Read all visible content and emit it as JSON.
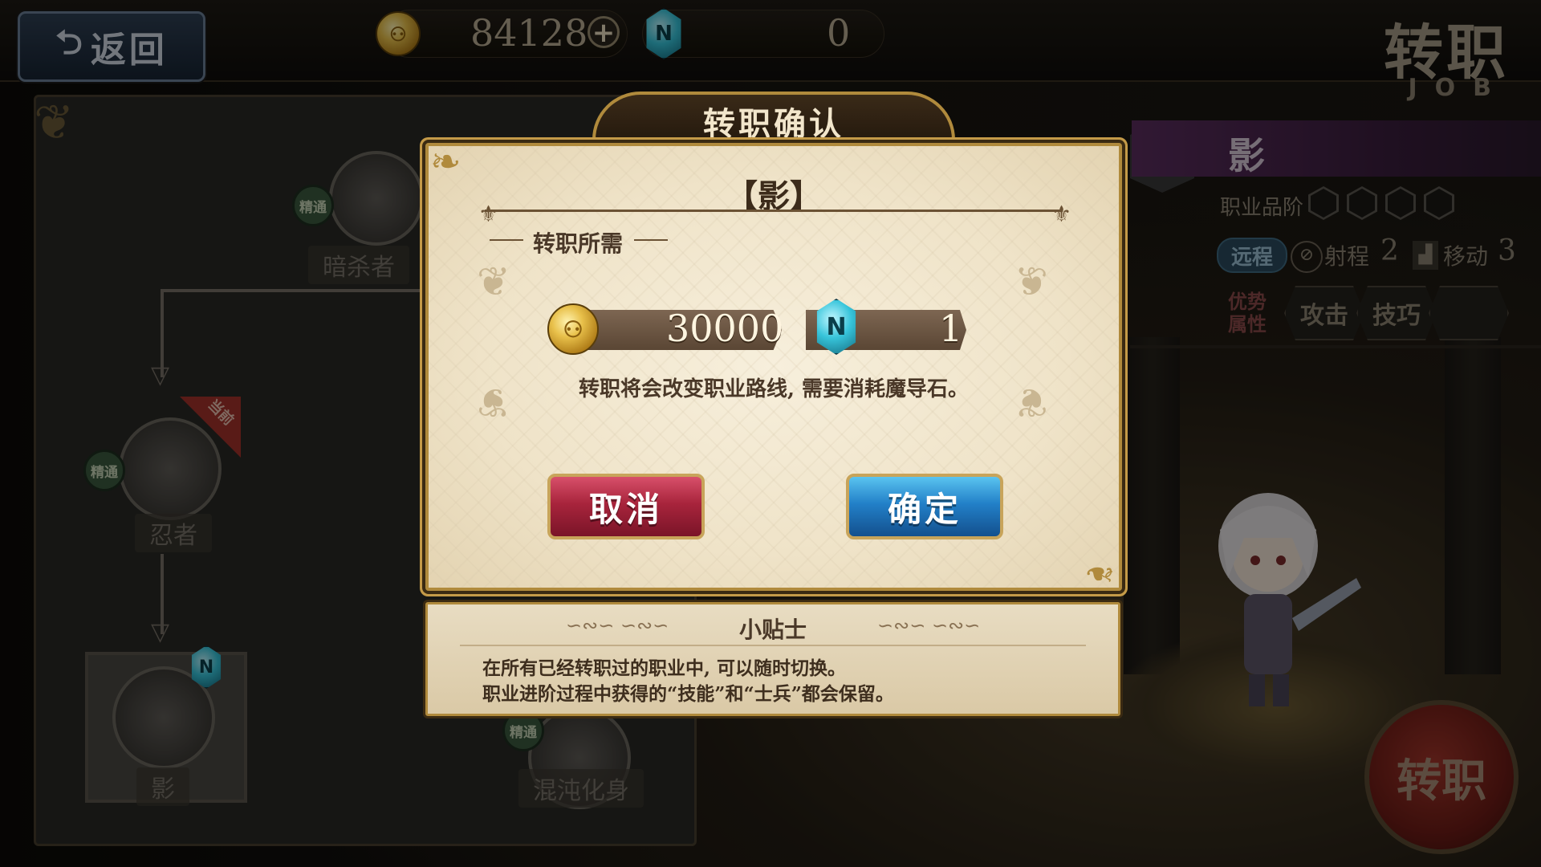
{
  "topbar": {
    "back_label": "返回",
    "coin_amount": "84128",
    "gem_amount": "0",
    "screen_title": "转职",
    "screen_subtitle": "JOB"
  },
  "tree": {
    "nodes": [
      {
        "name": "暗杀者",
        "badge": "精通"
      },
      {
        "name": "忍者",
        "badge": "精通",
        "tag": "当前"
      },
      {
        "name": "影"
      },
      {
        "name": "混沌化身",
        "badge": "精通"
      }
    ]
  },
  "right_panel": {
    "class_name": "影",
    "rank_label": "职业品阶",
    "range_type": "远程",
    "range_label": "射程",
    "range_value": "2",
    "move_label": "移动",
    "move_value": "3",
    "advantage_label_1": "优势",
    "advantage_label_2": "属性",
    "attributes": [
      "攻击",
      "技巧",
      ""
    ],
    "action_button": "转职"
  },
  "dialog": {
    "title": "转职确认",
    "job_name": "【影】",
    "requirement_label": "转职所需",
    "coin_cost": "30000",
    "gem_cost": "1",
    "description": "转职将会改变职业路线, 需要消耗魔导石。",
    "cancel_label": "取消",
    "confirm_label": "确定"
  },
  "tips": {
    "title": "小贴士",
    "lines": [
      "在所有已经转职过的职业中, 可以随时切换。",
      "职业进阶过程中获得的“技能”和“士兵”都会保留。"
    ]
  },
  "colors": {
    "dialog_border": "#b08a3c",
    "cancel_button": "#a8243c",
    "confirm_button": "#2280c8",
    "class_header": "#5a2d5e"
  }
}
